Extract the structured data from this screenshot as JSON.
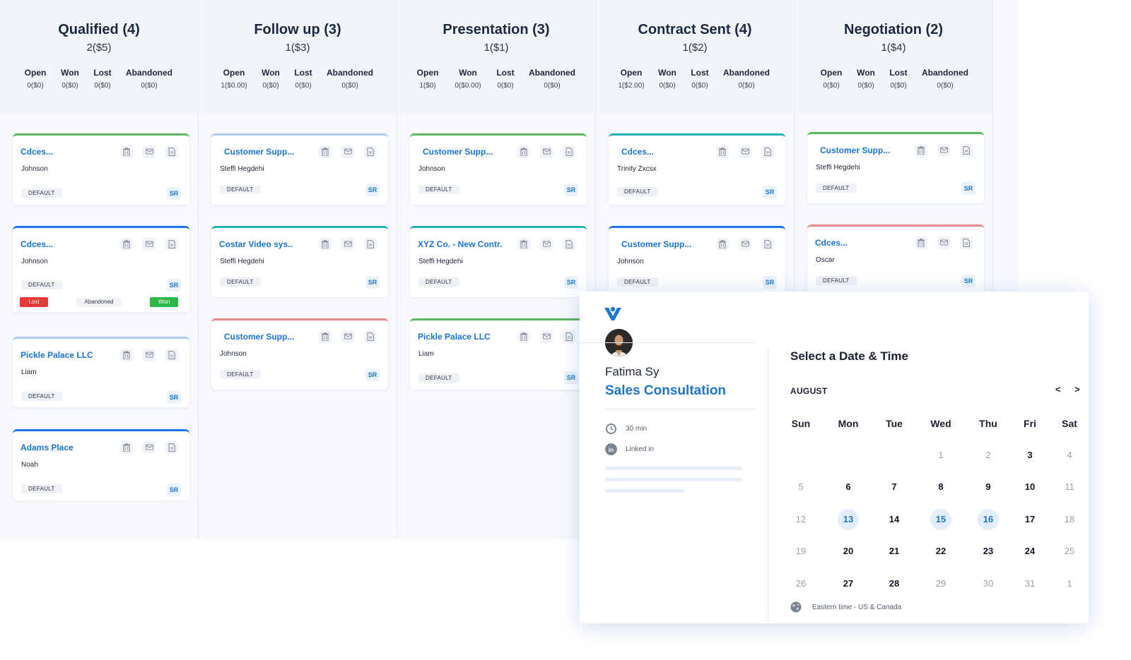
{
  "columns": [
    {
      "title": "Qualified (4)",
      "subtitle": "2($5)",
      "stats": [
        {
          "label": "Open",
          "value": "0($0)"
        },
        {
          "label": "Won",
          "value": "0($0)"
        },
        {
          "label": "Lost",
          "value": "0($0)"
        },
        {
          "label": "Abandoned",
          "value": "0($0)"
        }
      ],
      "cards": [
        {
          "title": "Cdces...",
          "person": "Johnson",
          "badge": "DEFAULT",
          "tag": "SR",
          "color": "#5cb85c"
        },
        {
          "title": "Cdces...",
          "person": "Johnson",
          "badge": "DEFAULT",
          "tag": "SR",
          "color": "#1e73e8",
          "status": {
            "lost": "Lost",
            "abandoned": "Abandoned",
            "won": "Won"
          }
        },
        {
          "title": "Pickle Palace LLC",
          "person": "Liam",
          "badge": "DEFAULT",
          "tag": "SR",
          "color": "#a9cdf5"
        },
        {
          "title": "Adams Place",
          "person": "Noah",
          "badge": "DEFAULT",
          "tag": "SR",
          "color": "#1e73e8"
        }
      ]
    },
    {
      "title": "Follow up (3)",
      "subtitle": "1($3)",
      "stats": [
        {
          "label": "Open",
          "value": "1($0.00)"
        },
        {
          "label": "Won",
          "value": "0($0)"
        },
        {
          "label": "Lost",
          "value": "0($0)"
        },
        {
          "label": "Abandoned",
          "value": "0($0)"
        }
      ],
      "cards": [
        {
          "title": "Customer Supp...",
          "person": "Steffi Hegdehi",
          "badge": "DEFAULT",
          "tag": "SR",
          "color": "#a9cdf5"
        },
        {
          "title": "Costar Video sys..",
          "person": "Steffi Hegdehi",
          "badge": "DEFAULT",
          "tag": "SR",
          "color": "#26b0b8"
        },
        {
          "title": "Customer Supp...",
          "person": "Johnson",
          "badge": "DEFAULT",
          "tag": "SR",
          "color": "#ef8a8a"
        }
      ]
    },
    {
      "title": "Presentation (3)",
      "subtitle": "1($1)",
      "stats": [
        {
          "label": "Open",
          "value": "1($0)"
        },
        {
          "label": "Won",
          "value": "0($0.00)"
        },
        {
          "label": "Lost",
          "value": "0($0)"
        },
        {
          "label": "Abandoned",
          "value": "0($0)"
        }
      ],
      "cards": [
        {
          "title": "Customer Supp...",
          "person": "Johnson",
          "badge": "DEFAULT",
          "tag": "SR",
          "color": "#5cb85c"
        },
        {
          "title": "XYZ Co. -  New Contr.",
          "person": "Steffi Hegdehi",
          "badge": "DEFAULT",
          "tag": "SR",
          "color": "#26b0b8"
        },
        {
          "title": "Pickle Palace LLC",
          "person": "Liam",
          "badge": "DEFAULT",
          "tag": "SR",
          "color": "#5cb85c"
        }
      ]
    },
    {
      "title": "Contract Sent (4)",
      "subtitle": "1($2)",
      "stats": [
        {
          "label": "Open",
          "value": "1($2.00)"
        },
        {
          "label": "Won",
          "value": "0($0)"
        },
        {
          "label": "Lost",
          "value": "0($0)"
        },
        {
          "label": "Abandoned",
          "value": "0($0)"
        }
      ],
      "cards": [
        {
          "title": "Cdces...",
          "person": "Trinity Zxcsx",
          "badge": "DEFAULT",
          "tag": "SR",
          "color": "#26b0b8"
        },
        {
          "title": "Customer Supp...",
          "person": "Johnson",
          "badge": "DEFAULT",
          "tag": "SR",
          "color": "#1e73e8"
        }
      ]
    },
    {
      "title": "Negotiation (2)",
      "subtitle": "1($4)",
      "stats": [
        {
          "label": "Open",
          "value": "0($0)"
        },
        {
          "label": "Won",
          "value": "0($0)"
        },
        {
          "label": "Lost",
          "value": "0($0)"
        },
        {
          "label": "Abandoned",
          "value": "0($0)"
        }
      ],
      "cards": [
        {
          "title": "Customer Supp...",
          "person": "Steffi Hegdehi",
          "badge": "DEFAULT",
          "tag": "SR",
          "color": "#5cb85c"
        },
        {
          "title": "Cdces...",
          "person": "Oscar",
          "badge": "DEFAULT",
          "tag": "SR",
          "color": "#ef8a8a"
        }
      ]
    }
  ],
  "booking": {
    "host": "Fatima Sy",
    "event": "Sales Consultation",
    "duration": "30 min",
    "location": "Linked in",
    "heading": "Select a Date & Time",
    "month": "AUGUST",
    "prev": "<",
    "next": ">",
    "weekdays": [
      "Sun",
      "Mon",
      "Tue",
      "Wed",
      "Thu",
      "Fri",
      "Sat"
    ],
    "weeks": [
      [
        {
          "d": "",
          "s": "muted"
        },
        {
          "d": "",
          "s": "muted"
        },
        {
          "d": "",
          "s": "muted"
        },
        {
          "d": "1",
          "s": "muted"
        },
        {
          "d": "2",
          "s": "muted"
        },
        {
          "d": "3",
          "s": "bold"
        },
        {
          "d": "4",
          "s": "muted"
        }
      ],
      [
        {
          "d": "5",
          "s": "muted"
        },
        {
          "d": "6",
          "s": "bold"
        },
        {
          "d": "7",
          "s": "bold"
        },
        {
          "d": "8",
          "s": "bold"
        },
        {
          "d": "9",
          "s": "bold"
        },
        {
          "d": "10",
          "s": "bold"
        },
        {
          "d": "11",
          "s": "muted"
        }
      ],
      [
        {
          "d": "12",
          "s": "muted"
        },
        {
          "d": "13",
          "s": "sel"
        },
        {
          "d": "14",
          "s": "bold"
        },
        {
          "d": "15",
          "s": "sel"
        },
        {
          "d": "16",
          "s": "sel"
        },
        {
          "d": "17",
          "s": "bold"
        },
        {
          "d": "18",
          "s": "muted"
        }
      ],
      [
        {
          "d": "19",
          "s": "muted"
        },
        {
          "d": "20",
          "s": "bold"
        },
        {
          "d": "21",
          "s": "bold"
        },
        {
          "d": "22",
          "s": "bold"
        },
        {
          "d": "23",
          "s": "bold"
        },
        {
          "d": "24",
          "s": "bold"
        },
        {
          "d": "25",
          "s": "muted"
        }
      ],
      [
        {
          "d": "26",
          "s": "muted"
        },
        {
          "d": "27",
          "s": "bold"
        },
        {
          "d": "28",
          "s": "bold"
        },
        {
          "d": "29",
          "s": "muted"
        },
        {
          "d": "30",
          "s": "muted"
        },
        {
          "d": "31",
          "s": "muted"
        },
        {
          "d": "1",
          "s": "muted"
        }
      ]
    ],
    "timezone": "Eastern time - US & Canada",
    "accent": "#1b74d6"
  }
}
